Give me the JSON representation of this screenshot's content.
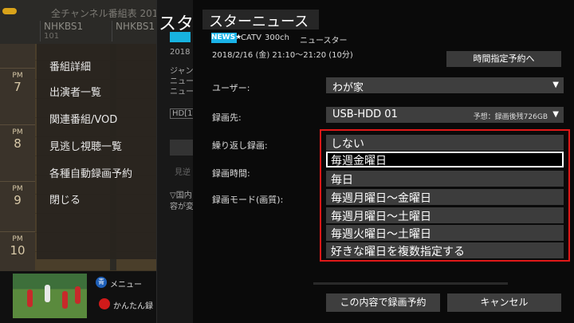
{
  "epg": {
    "header_text": "全チャンネル番組表 2018",
    "channels": [
      {
        "name": "NHKBS1",
        "number": "101"
      },
      {
        "name": "NHKBS1",
        "number": ""
      }
    ],
    "hours": [
      {
        "pm": "PM",
        "h": "7"
      },
      {
        "pm": "PM",
        "h": "8"
      },
      {
        "pm": "PM",
        "h": "9"
      },
      {
        "pm": "PM",
        "h": "10"
      }
    ],
    "menu_button": {
      "color_label": "青",
      "label": "メニュー"
    },
    "easy_rec_button": {
      "label": "かんたん録"
    }
  },
  "context_menu": {
    "items": [
      "番組詳細",
      "出演者一覧",
      "関連番組/VOD",
      "見逃し視聴一覧",
      "各種自動録画予約",
      "閉じる"
    ]
  },
  "mid_panel": {
    "title": "スタ",
    "badge": "NEWS★",
    "date": "2018",
    "lines": [
      "ジャン",
      "ニュー",
      "ニュー"
    ],
    "tag": "HD[1(",
    "mini_btn": "見逆",
    "footer": [
      "▽国内",
      "容が変"
    ]
  },
  "dialog": {
    "title": "スターニュース",
    "badge": "NEWS★",
    "network": "CATV",
    "channel": "300ch",
    "genre": "ニュースター",
    "datetime": "2018/2/16 (金) 21:10～21:20 (10分)",
    "timer_button": "時間指定予約へ",
    "fields": {
      "user_label": "ユーザー:",
      "user_value": "わが家",
      "dest_label": "録画先:",
      "dest_value": "USB-HDD 01",
      "dest_aux": "予想：録画後残726GB",
      "repeat_label": "繰り返し録画:",
      "time_label": "録画時間:",
      "mode_label": "録画モード(画質):"
    },
    "repeat_options": [
      "しない",
      "毎週金曜日",
      "毎日",
      "毎週月曜日～金曜日",
      "毎週月曜日～土曜日",
      "毎週火曜日～土曜日",
      "好きな曜日を複数指定する"
    ],
    "repeat_selected_index": 1,
    "confirm_button": "この内容で録画予約",
    "cancel_button": "キャンセル",
    "arrow_glyph": "▼"
  },
  "colors": {
    "highlight_frame": "#e01818",
    "badge": "#1ab3e8"
  }
}
